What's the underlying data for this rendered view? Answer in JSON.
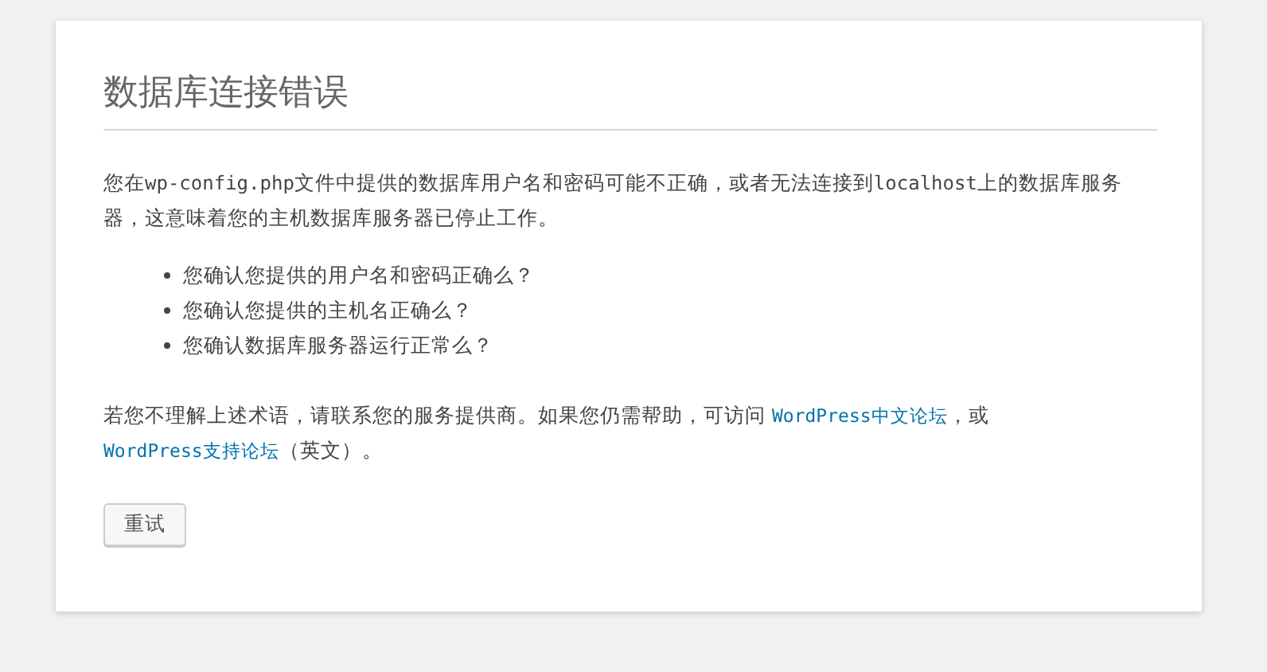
{
  "title": "数据库连接错误",
  "intro": [
    {
      "kind": "plain",
      "text": "您在"
    },
    {
      "kind": "code",
      "text": "wp-config.php"
    },
    {
      "kind": "plain",
      "text": "文件中提供的数据库用户名和密码可能不正确，或者无法连接到"
    },
    {
      "kind": "code",
      "text": "localhost"
    },
    {
      "kind": "plain",
      "text": "上的数据库服务器，这意味着您的主机数据库服务器已停止工作。"
    }
  ],
  "checks": [
    "您确认您提供的用户名和密码正确么？",
    "您确认您提供的主机名正确么？",
    "您确认数据库服务器运行正常么？"
  ],
  "help": [
    {
      "kind": "plain",
      "text": "若您不理解上述术语，请联系您的服务提供商。如果您仍需帮助，可访问 "
    },
    {
      "kind": "link",
      "text": "WordPress中文论坛"
    },
    {
      "kind": "plain",
      "text": "，或"
    },
    {
      "kind": "link",
      "text": "WordPress支持论坛"
    },
    {
      "kind": "plain",
      "text": "（英文）。"
    }
  ],
  "button": "重试"
}
